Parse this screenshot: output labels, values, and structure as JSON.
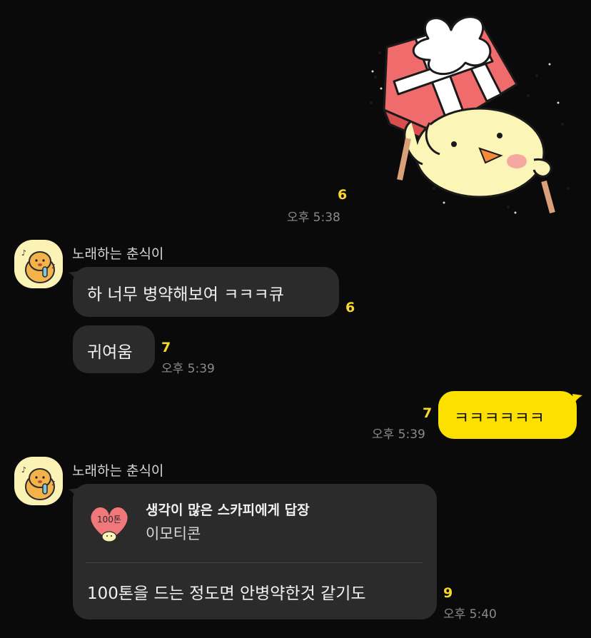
{
  "colors": {
    "background": "#0a0a0a",
    "bubble_other": "#2b2b2b",
    "bubble_me": "#fbe000",
    "unread": "#f7d82b",
    "time": "#8a8a8a"
  },
  "messages": {
    "m1": {
      "type": "sticker",
      "from": "me",
      "sticker": "chick-with-gift-sticker",
      "unread": "6",
      "time": "오후 5:38"
    },
    "group1": {
      "sender": "노래하는 춘식이",
      "avatar": "singing-chunsik-avatar"
    },
    "m2": {
      "text": "하 너무 병약해보여 ㅋㅋㅋ큐",
      "unread": "6"
    },
    "m3": {
      "text": "귀여움",
      "unread": "7",
      "time": "오후 5:39"
    },
    "m4": {
      "text": "ㅋㅋㅋㅋㅋㅋ",
      "unread": "7",
      "time": "오후 5:39",
      "from": "me"
    },
    "group2": {
      "sender": "노래하는 춘식이",
      "avatar": "singing-chunsik-avatar"
    },
    "m5": {
      "reply_title": "생각이 많은 스카피에게 답장",
      "reply_subtitle": "이모티콘",
      "reply_thumb": "heart-100-emoticon",
      "reply_thumb_text": "100톤",
      "text": "100톤을 드는 정도면 안병약한것 같기도",
      "unread": "9",
      "time": "오후 5:40"
    }
  }
}
